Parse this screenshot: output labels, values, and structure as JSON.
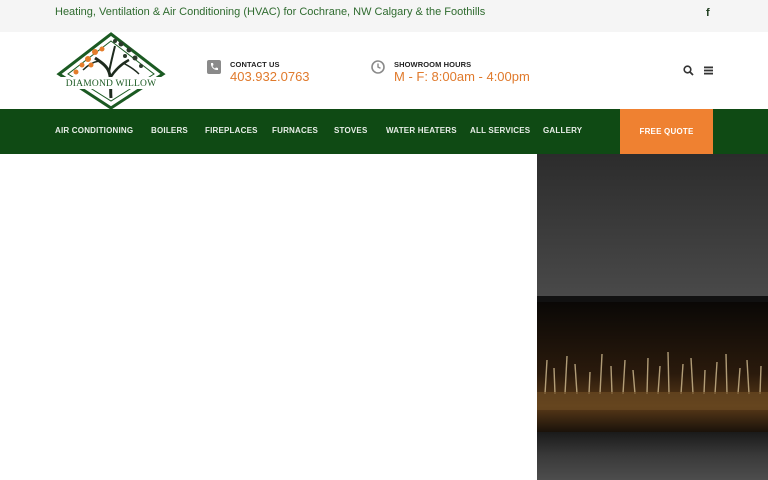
{
  "topbar": {
    "tagline": "Heating, Ventilation & Air Conditioning (HVAC) for Cochrane, NW Calgary & the Foothills",
    "facebook": "f"
  },
  "logo": {
    "text": "DIAMOND WILLOW"
  },
  "contact": {
    "label": "CONTACT US",
    "phone": "403.932.0763"
  },
  "hours": {
    "label": "SHOWROOM HOURS",
    "value": "M - F: 8:00am - 4:00pm"
  },
  "nav": {
    "items": [
      "AIR CONDITIONING",
      "BOILERS",
      "FIREPLACES",
      "FURNACES",
      "STOVES",
      "WATER HEATERS",
      "ALL SERVICES",
      "GALLERY"
    ],
    "cta": "FREE QUOTE"
  },
  "colors": {
    "brand_green": "#0f4a14",
    "accent_orange": "#ef8131",
    "tagline_green": "#2f6b2f"
  },
  "icons": [
    "facebook-icon",
    "phone-icon",
    "clock-icon",
    "search-icon",
    "menu-icon"
  ]
}
